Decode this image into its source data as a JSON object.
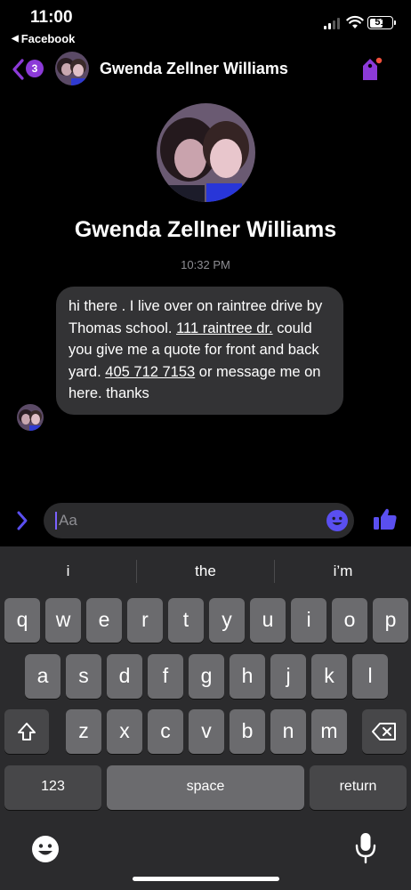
{
  "status_bar": {
    "time": "11:00",
    "back_app": "Facebook",
    "battery": "51"
  },
  "header": {
    "unread_count": "3",
    "contact_name": "Gwenda Zellner Williams"
  },
  "profile": {
    "name": "Gwenda Zellner Williams"
  },
  "conversation": {
    "timestamp": "10:32 PM",
    "message": {
      "parts": [
        {
          "text": "hi there .  I live over on raintree drive by Thomas school. "
        },
        {
          "text": "111 raintree dr.",
          "link": true
        },
        {
          "text": " could you give me a quote for front and back yard.  "
        },
        {
          "text": "405 712 7153",
          "link": true
        },
        {
          "text": " or message me on here. thanks"
        }
      ]
    }
  },
  "composer": {
    "placeholder": "Aa"
  },
  "keyboard": {
    "suggestions": [
      "i",
      "the",
      "i’m"
    ],
    "row1": [
      "q",
      "w",
      "e",
      "r",
      "t",
      "y",
      "u",
      "i",
      "o",
      "p"
    ],
    "row2": [
      "a",
      "s",
      "d",
      "f",
      "g",
      "h",
      "j",
      "k",
      "l"
    ],
    "row3": [
      "z",
      "x",
      "c",
      "v",
      "b",
      "n",
      "m"
    ],
    "numbers_label": "123",
    "space_label": "space",
    "return_label": "return"
  },
  "colors": {
    "accent": "#8c3ad8",
    "messenger_blue": "#5a4ff0",
    "bubble": "#333335"
  }
}
